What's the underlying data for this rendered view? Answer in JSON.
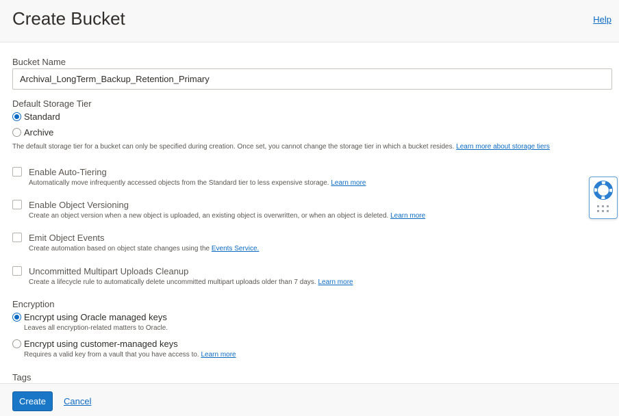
{
  "header": {
    "title": "Create Bucket",
    "help_link": "Help"
  },
  "bucket_name": {
    "label": "Bucket Name",
    "value": "Archival_LongTerm_Backup_Retention_Primary"
  },
  "storage_tier": {
    "label": "Default Storage Tier",
    "options": [
      "Standard",
      "Archive"
    ],
    "selected": "Standard",
    "help_text": "The default storage tier for a bucket can only be specified during creation. Once set, you cannot change the storage tier in which a bucket resides.",
    "help_link": "Learn more about storage tiers"
  },
  "checkboxes": [
    {
      "label": "Enable Auto-Tiering",
      "checked": false,
      "help_text": "Automatically move infrequently accessed objects from the Standard tier to less expensive storage.",
      "link": "Learn more"
    },
    {
      "label": "Enable Object Versioning",
      "checked": false,
      "help_text": "Create an object version when a new object is uploaded, an existing object is overwritten, or when an object is deleted.",
      "link": "Learn more"
    },
    {
      "label": "Emit Object Events",
      "checked": false,
      "help_text": "Create automation based on object state changes using the",
      "link": "Events Service."
    },
    {
      "label": "Uncommitted Multipart Uploads Cleanup",
      "checked": false,
      "help_text": "Create a lifecycle rule to automatically delete uncommitted multipart uploads older than 7 days.",
      "link": "Learn more"
    }
  ],
  "encryption": {
    "label": "Encryption",
    "options": [
      {
        "label": "Encrypt using Oracle managed keys",
        "help_text": "Leaves all encryption-related matters to Oracle.",
        "link": ""
      },
      {
        "label": "Encrypt using customer-managed keys",
        "help_text": "Requires a valid key from a vault that you have access to.",
        "link": "Learn more"
      }
    ],
    "selected": "Encrypt using Oracle managed keys"
  },
  "tags": {
    "label": "Tags"
  },
  "footer": {
    "create_label": "Create",
    "cancel_label": "Cancel"
  },
  "floating_help": {
    "icons": [
      "lifebuoy-icon",
      "grid-dots-icon"
    ]
  },
  "colors": {
    "accent": "#0a6ac3",
    "button": "#1a77c7"
  }
}
